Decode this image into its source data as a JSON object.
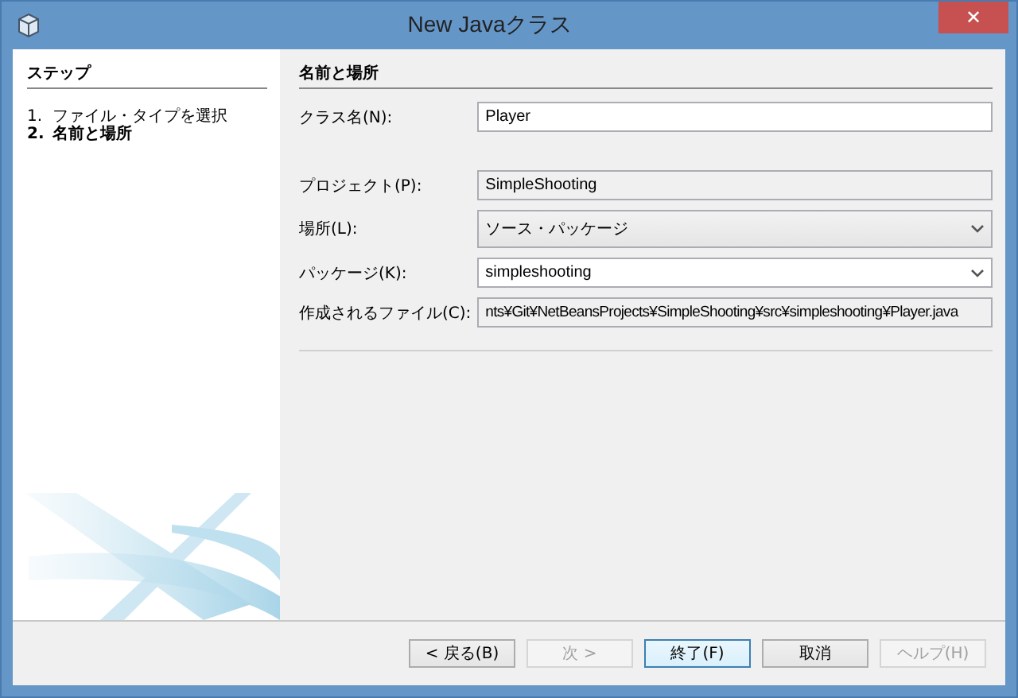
{
  "window": {
    "title": "New Javaクラス",
    "close": "✕"
  },
  "steps": {
    "title": "ステップ",
    "items": [
      {
        "number": "1.",
        "label": "ファイル・タイプを選択",
        "selected": false
      },
      {
        "number": "2.",
        "label": "名前と場所",
        "selected": true
      }
    ]
  },
  "panel": {
    "title": "名前と場所",
    "fields": [
      {
        "kind": "text",
        "label": "クラス名(N):",
        "value": "Player",
        "editable": true
      },
      {
        "kind": "text",
        "label": "プロジェクト(P):",
        "value": "SimpleShooting",
        "editable": false
      },
      {
        "kind": "combo",
        "label": "場所(L):",
        "value": "ソース・パッケージ",
        "editable": false
      },
      {
        "kind": "combo",
        "label": "パッケージ(K):",
        "value": "simpleshooting",
        "editable": true
      },
      {
        "kind": "text",
        "label": "作成されるファイル(C):",
        "value": "nts¥Git¥NetBeansProjects¥SimpleShooting¥src¥simpleshooting¥Player.java",
        "editable": false
      }
    ]
  },
  "buttons": [
    {
      "label": "< 戻る(B)",
      "disabled": false,
      "default": false
    },
    {
      "label": "次 >",
      "disabled": true,
      "default": false
    },
    {
      "label": "終了(F)",
      "disabled": false,
      "default": true
    },
    {
      "label": "取消",
      "disabled": false,
      "default": false
    },
    {
      "label": "ヘルプ(H)",
      "disabled": true,
      "default": false
    }
  ]
}
